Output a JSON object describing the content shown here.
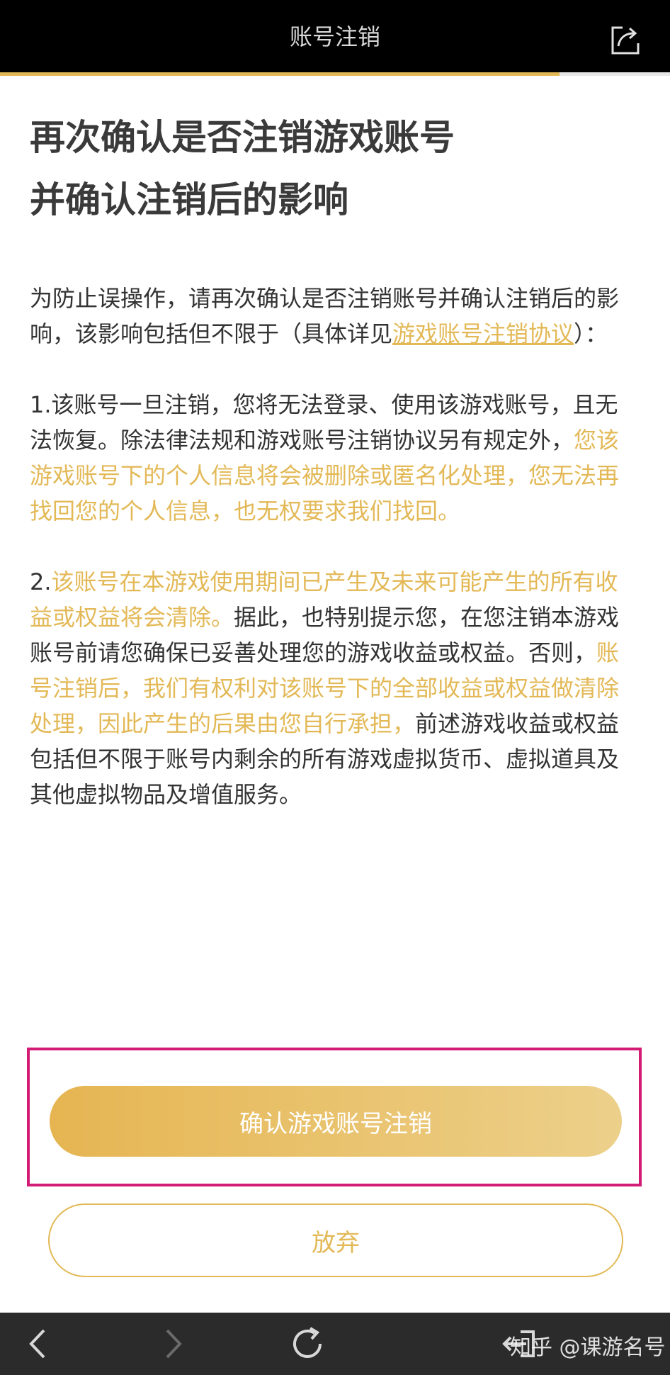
{
  "header": {
    "title": "账号注销",
    "progress_fraction": 0.835
  },
  "main": {
    "heading_line1": "再次确认是否注销游戏账号",
    "heading_line2": "并确认注销后的影响",
    "intro": {
      "text": "为防止误操作，请再次确认是否注销账号并确认注销后的影响，该影响包括但不限于（具体详见",
      "link": "游戏账号注销协议",
      "suffix": "）："
    },
    "item1": {
      "prefix": "1.该账号一旦注销，您将无法登录、使用该游戏账号，且无法恢复。除法律法规和游戏账号注销协议另有规定外，",
      "highlight": "您该游戏账号下的个人信息将会被删除或匿名化处理，您无法再找回您的个人信息，也无权要求我们找回。"
    },
    "item2": {
      "prefix": "2.",
      "highlight1": "该账号在本游戏使用期间已产生及未来可能产生的所有收益或权益将会清除。",
      "middle": "据此，也特别提示您，在您注销本游戏账号前请您确保已妥善处理您的游戏收益或权益。否则，",
      "highlight2": "账号注销后，我们有权利对该账号下的全部收益或权益做清除处理，因此产生的后果由您自行承担，",
      "suffix": "前述游戏收益或权益包括但不限于账号内剩余的所有游戏虚拟货币、虚拟道具及其他虚拟物品及增值服务。"
    },
    "confirm_button": "确认游戏账号注销",
    "cancel_button": "放弃"
  },
  "bottom": {
    "watermark": "知乎 @课游名号"
  },
  "colors": {
    "accent": "#e3b957",
    "highlight_border": "#d21b74",
    "topbar": "#000000",
    "bottombar": "#2b2b2b"
  },
  "icons": {
    "share": "share-icon",
    "back": "chevron-left-icon",
    "forward": "chevron-right-icon",
    "refresh": "refresh-icon",
    "exit": "exit-icon"
  }
}
